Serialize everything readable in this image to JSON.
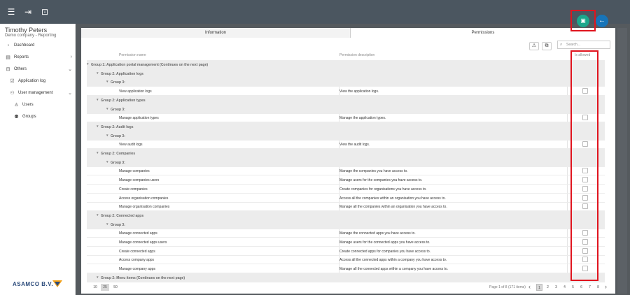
{
  "topbar": {
    "icons": [
      "menu-icon",
      "logout-icon",
      "window-icon"
    ]
  },
  "user": {
    "name": "Timothy Peters",
    "company": "Demo company - Reporting"
  },
  "sidebar": {
    "items": [
      {
        "label": "Dashboard",
        "icon": "dashboard-icon"
      },
      {
        "label": "Reports",
        "icon": "reports-icon"
      },
      {
        "label": "Others",
        "icon": "others-icon"
      },
      {
        "label": "Application log",
        "icon": "log-icon"
      },
      {
        "label": "User management",
        "icon": "user-management-icon"
      },
      {
        "label": "Users",
        "icon": "users-icon"
      },
      {
        "label": "Groups",
        "icon": "groups-icon"
      }
    ],
    "brand": "ASAMCO B.V."
  },
  "tabs": [
    {
      "label": "Information"
    },
    {
      "label": "Permissions"
    }
  ],
  "search": {
    "placeholder": "Search..."
  },
  "table": {
    "headers": {
      "name": "Permission name",
      "description": "Permission description",
      "allowed": "Is allowed"
    },
    "rows": [
      {
        "type": "group",
        "level": 1,
        "name": "Group 1: Application portal management (Continues on the next page)",
        "description": ""
      },
      {
        "type": "group",
        "level": 2,
        "name": "Group 2: Application logs",
        "description": ""
      },
      {
        "type": "group",
        "level": 3,
        "name": "Group 3:",
        "description": ""
      },
      {
        "type": "item",
        "level": 4,
        "name": "View application logs",
        "description": "View the application logs."
      },
      {
        "type": "group",
        "level": 2,
        "name": "Group 2: Application types",
        "description": ""
      },
      {
        "type": "group",
        "level": 3,
        "name": "Group 3:",
        "description": ""
      },
      {
        "type": "item",
        "level": 4,
        "name": "Manage application types",
        "description": "Manage the application types."
      },
      {
        "type": "group",
        "level": 2,
        "name": "Group 2: Audit logs",
        "description": ""
      },
      {
        "type": "group",
        "level": 3,
        "name": "Group 3:",
        "description": ""
      },
      {
        "type": "item",
        "level": 4,
        "name": "View audit logs",
        "description": "View the audit logs."
      },
      {
        "type": "group",
        "level": 2,
        "name": "Group 2: Companies",
        "description": ""
      },
      {
        "type": "group",
        "level": 3,
        "name": "Group 3:",
        "description": ""
      },
      {
        "type": "item",
        "level": 4,
        "name": "Manage companies",
        "description": "Manage the companies you have access to."
      },
      {
        "type": "item",
        "level": 4,
        "name": "Manage companies users",
        "description": "Manage users for the companies you have access to."
      },
      {
        "type": "item",
        "level": 4,
        "name": "Create companies",
        "description": "Create companies for organisations you have access to."
      },
      {
        "type": "item",
        "level": 4,
        "name": "Access organisation companies",
        "description": "Access all the companies within an organisation you have access to."
      },
      {
        "type": "item",
        "level": 4,
        "name": "Manage organisation companies",
        "description": "Manage all the companies within an organisation you have access to."
      },
      {
        "type": "group",
        "level": 2,
        "name": "Group 2: Connected apps",
        "description": ""
      },
      {
        "type": "group",
        "level": 3,
        "name": "Group 3:",
        "description": ""
      },
      {
        "type": "item",
        "level": 4,
        "name": "Manage connected apps",
        "description": "Manage the connected apps you have access to."
      },
      {
        "type": "item",
        "level": 4,
        "name": "Manage connected apps users",
        "description": "Manage users for the connected apps you have access to."
      },
      {
        "type": "item",
        "level": 4,
        "name": "Create connected apps",
        "description": "Create connected apps for companies you have access to."
      },
      {
        "type": "item",
        "level": 4,
        "name": "Access company apps",
        "description": "Access all the connected apps within a company you have access to."
      },
      {
        "type": "item",
        "level": 4,
        "name": "Manage company apps",
        "description": "Manage all the connected apps within a company you have access to."
      },
      {
        "type": "group",
        "level": 2,
        "name": "Group 2: Menu items (Continues on the next page)",
        "description": ""
      }
    ]
  },
  "pager": {
    "sizes": [
      "10",
      "25",
      "50"
    ],
    "selected_size": "25",
    "info": "Page 1 of 8 (171 items)",
    "pages": [
      "1",
      "2",
      "3",
      "4",
      "5",
      "6",
      "7",
      "8"
    ],
    "current_page": "1"
  },
  "colors": {
    "topbar": "#4b5660",
    "save": "#1ba78c",
    "back": "#1774b8",
    "highlight": "#e0141e"
  }
}
